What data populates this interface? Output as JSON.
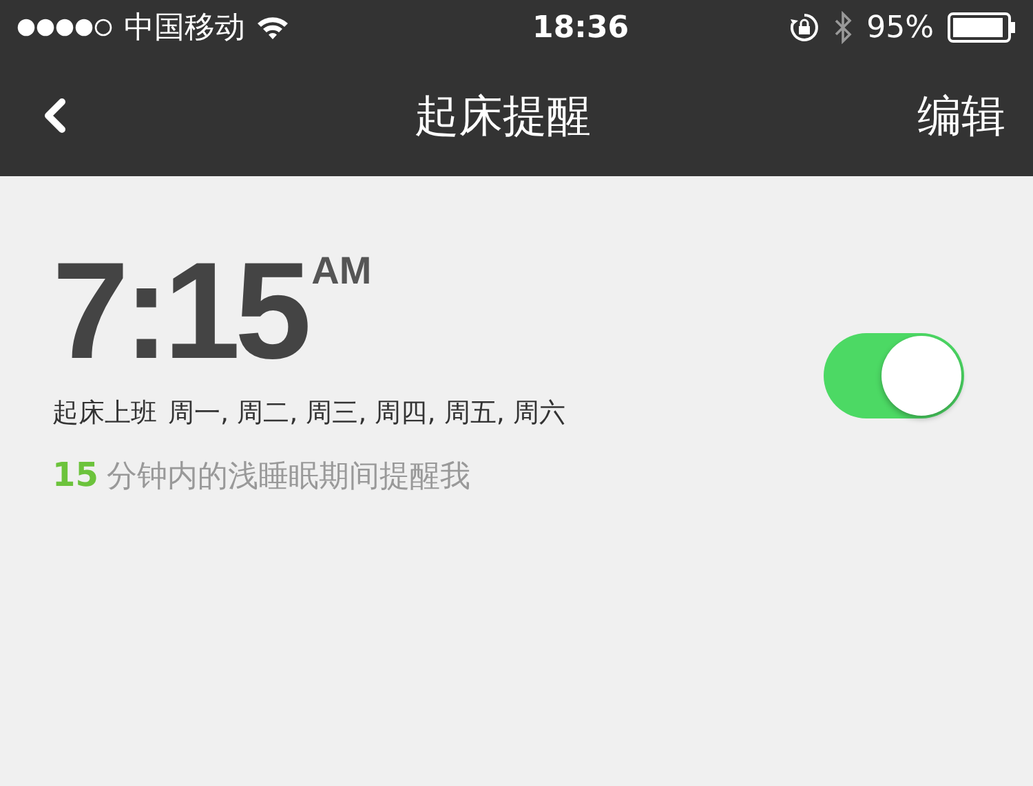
{
  "status_bar": {
    "carrier": "中国移动",
    "time": "18:36",
    "battery": "95%"
  },
  "nav": {
    "title": "起床提醒",
    "action": "编辑"
  },
  "alarm": {
    "time": "7:15",
    "period": "AM",
    "label": "起床上班",
    "days": "周一, 周二, 周三, 周四, 周五, 周六",
    "on": true,
    "smart_minutes": "15",
    "smart_text": "分钟内的浅睡眠期间提醒我"
  }
}
